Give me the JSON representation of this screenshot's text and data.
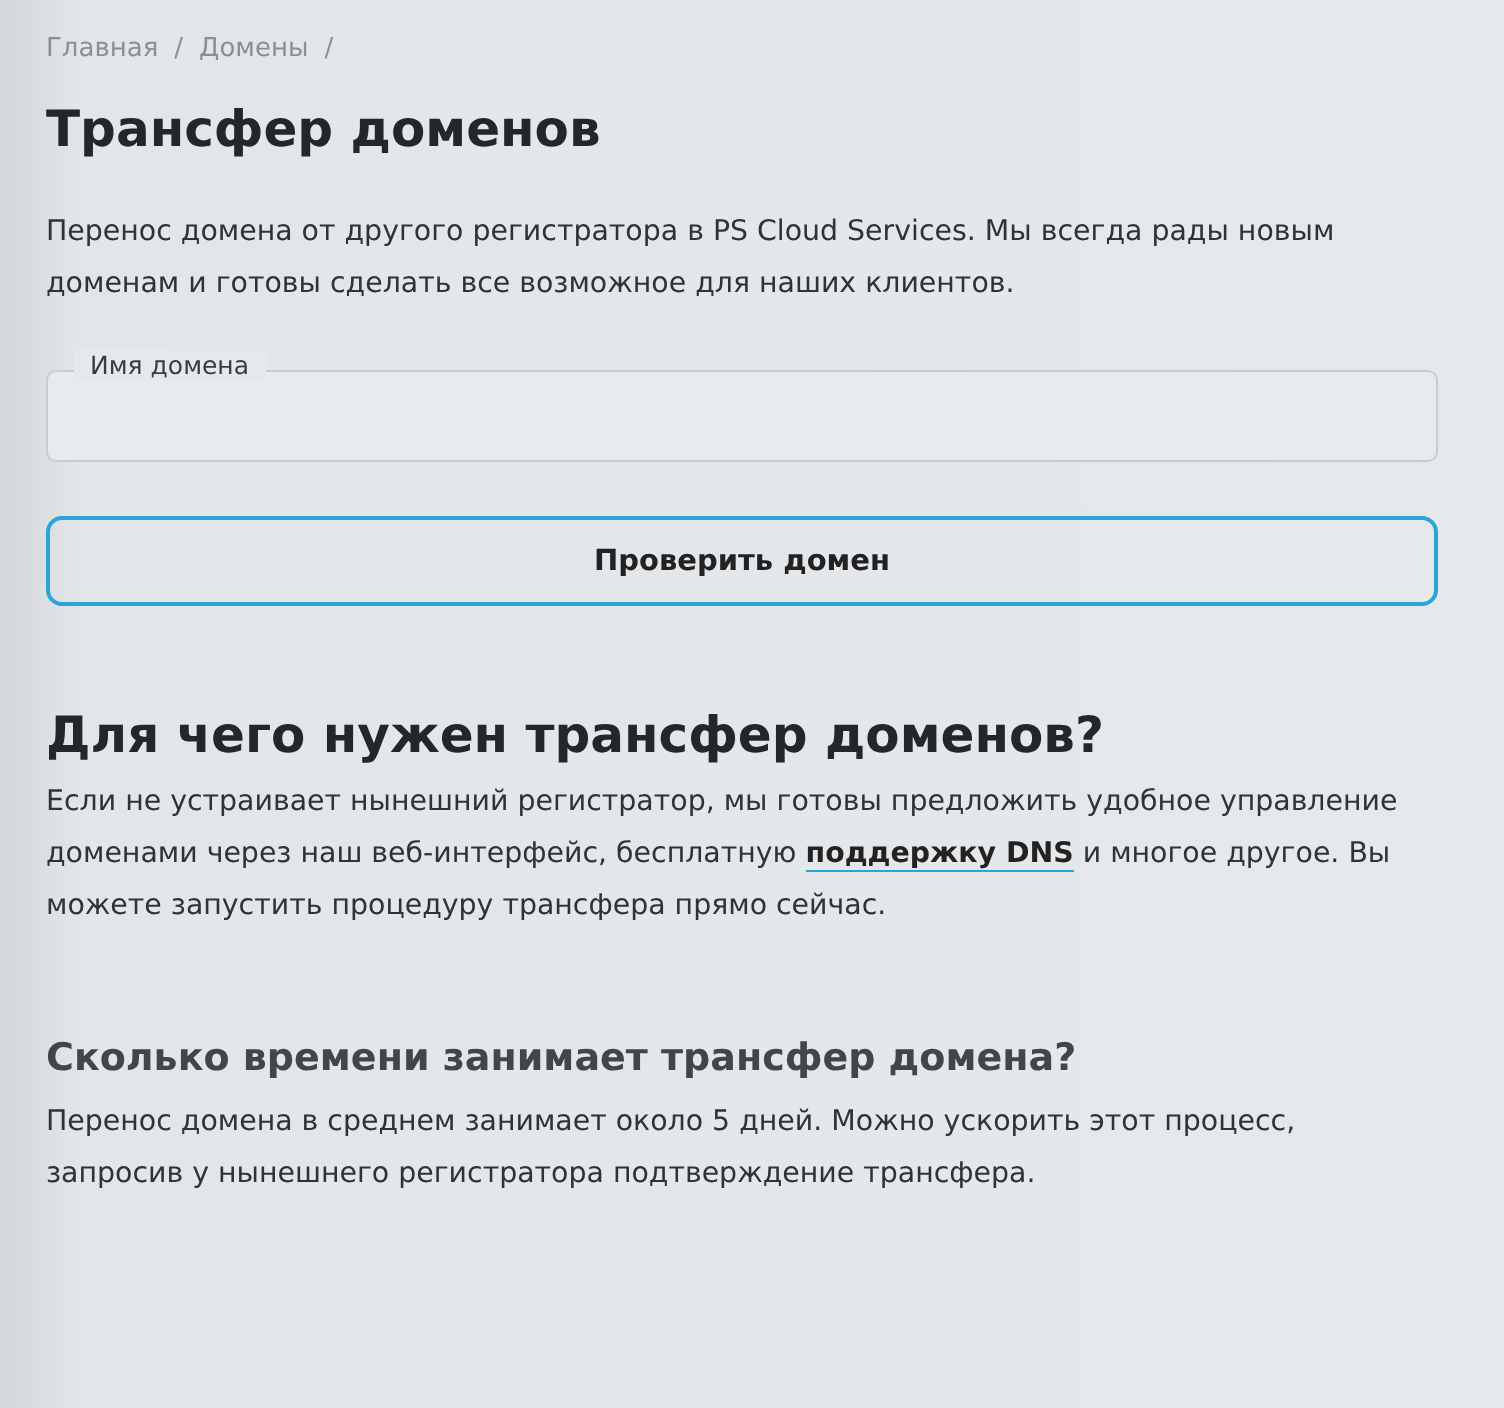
{
  "breadcrumbs": [
    {
      "label": "Главная",
      "separator": "/"
    },
    {
      "label": "Домены",
      "separator": "/"
    }
  ],
  "title": "Трансфер доменов",
  "intro": "Перенос домена от другого регистратора в PS Cloud Services. Мы всегда рады новым доменам и готовы сделать все возможное для наших клиентов.",
  "domain_field": {
    "label": "Имя домена"
  },
  "check_button": "Проверить домен",
  "sections": [
    {
      "heading": "Для чего нужен трансфер доменов?",
      "kind": "major",
      "text_before": "Если не устраивает нынешний регистратор, мы готовы предложить удобное управление доменами через наш веб-интерфейс, бесплатную",
      "link": "поддержку DNS",
      "text_after": "и многое другое. Вы можете запустить процедуру трансфера прямо сейчас."
    },
    {
      "heading": "Сколько времени занимает трансфер домена?",
      "kind": "minor",
      "text_before": "Перенос домена в среднем занимает около 5 дней. Можно ускорить этот процесс, запросив у нынешнего регистратора подтверждение трансфера."
    }
  ]
}
